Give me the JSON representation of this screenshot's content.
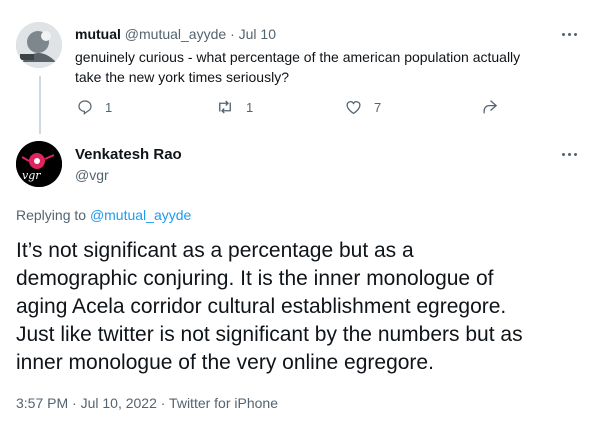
{
  "parent_tweet": {
    "display_name": "mutual",
    "handle": "@mutual_ayyde",
    "separator": "·",
    "date": "Jul 10",
    "text_line1": "genuinely curious - what percentage of the american population actually",
    "text_line2": "take the new york times seriously?",
    "reply_count": "1",
    "retweet_count": "1",
    "like_count": "7",
    "colors": {
      "avatar_bg": "#9aa4a8"
    }
  },
  "main_tweet": {
    "display_name": "Venkatesh Rao",
    "handle": "@vgr",
    "replying_prefix": "Replying to",
    "replying_to": "@mutual_ayyde",
    "text_lines": [
      "It’s not significant as a percentage but as a",
      "demographic conjuring. It is the inner monologue of",
      "aging Acela corridor cultural establishment egregore.",
      "Just like twitter is not significant by the numbers but as",
      "inner monologue of the very online egregore."
    ],
    "timestamp": "3:57 PM · Jul 10, 2022 · Twitter for iPhone",
    "avatar_text": "vgr",
    "colors": {
      "avatar_bg": "#000000",
      "avatar_text": "#ffffff",
      "accent": "#e0245e"
    }
  },
  "icons": {
    "reply": "reply-icon",
    "retweet": "retweet-icon",
    "like": "heart-icon",
    "share": "share-icon",
    "more": "more-icon"
  },
  "colors": {
    "link": "#1d9bf0",
    "muted": "#536471",
    "text": "#0f1419"
  }
}
